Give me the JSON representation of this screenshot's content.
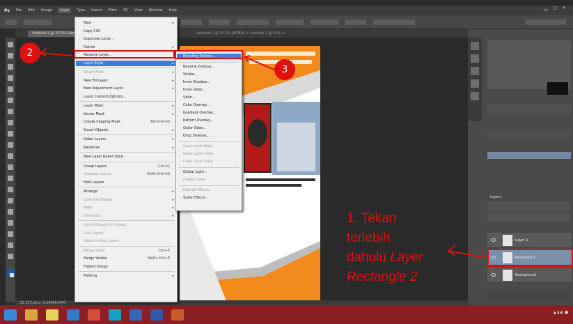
{
  "menubar": {
    "logo": "Ps",
    "items": [
      "File",
      "Edit",
      "Image",
      "Layer",
      "Type",
      "Select",
      "Filter",
      "3D",
      "View",
      "Window",
      "Help"
    ]
  },
  "document_tab": {
    "title": "Untitled-1 @ 33.3% (Rectangle 2, RGB/8)",
    "other_tabs": "Untitled-2 @ 33.3% (RGB/8) ×   Untitled-3 @ 50% ×"
  },
  "layer_menu": {
    "items": [
      {
        "label": "New",
        "shortcut": "▸"
      },
      {
        "label": "Copy CSS",
        "shortcut": ""
      },
      {
        "label": "Duplicate Layer...",
        "shortcut": ""
      },
      {
        "label": "Delete",
        "shortcut": "▸"
      },
      {
        "label": "Rename Layer...",
        "shortcut": ""
      },
      {
        "label": "Layer Style",
        "shortcut": "▸",
        "highlighted": true
      },
      {
        "label": "Smart Filter",
        "shortcut": "▸",
        "dim": true
      },
      {
        "label": "New Fill Layer",
        "shortcut": "▸"
      },
      {
        "label": "New Adjustment Layer",
        "shortcut": "▸"
      },
      {
        "label": "Layer Content Options...",
        "shortcut": ""
      },
      {
        "label": "Layer Mask",
        "shortcut": "▸"
      },
      {
        "label": "Vector Mask",
        "shortcut": "▸"
      },
      {
        "label": "Create Clipping Mask",
        "shortcut": "Alt+Ctrl+G"
      },
      {
        "label": "Smart Objects",
        "shortcut": "▸"
      },
      {
        "label": "Video Layers",
        "shortcut": "▸"
      },
      {
        "label": "Rasterize",
        "shortcut": "▸"
      },
      {
        "label": "New Layer Based Slice",
        "shortcut": ""
      },
      {
        "label": "Group Layers",
        "shortcut": "Ctrl+G"
      },
      {
        "label": "Ungroup Layers",
        "shortcut": "Shift+Ctrl+G",
        "dim": true
      },
      {
        "label": "Hide Layers",
        "shortcut": ""
      },
      {
        "label": "Arrange",
        "shortcut": "▸"
      },
      {
        "label": "Combine Shapes",
        "shortcut": "▸",
        "dim": true
      },
      {
        "label": "Align",
        "shortcut": "▸",
        "dim": true
      },
      {
        "label": "Distribute",
        "shortcut": "▸",
        "dim": true
      },
      {
        "label": "Lock All Layers in Group...",
        "shortcut": "",
        "dim": true
      },
      {
        "label": "Link Layers",
        "shortcut": "",
        "dim": true
      },
      {
        "label": "Select Linked Layers",
        "shortcut": "",
        "dim": true
      },
      {
        "label": "Merge Down",
        "shortcut": "Ctrl+E",
        "dim": true
      },
      {
        "label": "Merge Visible",
        "shortcut": "Shift+Ctrl+E"
      },
      {
        "label": "Flatten Image",
        "shortcut": ""
      },
      {
        "label": "Matting",
        "shortcut": "▸"
      }
    ]
  },
  "layer_style_submenu": {
    "items": [
      {
        "label": "Blending Options...",
        "highlighted": true
      },
      {
        "label": "Bevel & Emboss..."
      },
      {
        "label": "Stroke..."
      },
      {
        "label": "Inner Shadow..."
      },
      {
        "label": "Inner Glow..."
      },
      {
        "label": "Satin..."
      },
      {
        "label": "Color Overlay..."
      },
      {
        "label": "Gradient Overlay..."
      },
      {
        "label": "Pattern Overlay..."
      },
      {
        "label": "Outer Glow..."
      },
      {
        "label": "Drop Shadow..."
      },
      {
        "label": "Copy Layer Style",
        "dim": true
      },
      {
        "label": "Paste Layer Style",
        "dim": true
      },
      {
        "label": "Clear Layer Style",
        "dim": true
      },
      {
        "label": "Global Light..."
      },
      {
        "label": "Create Layer",
        "dim": true
      },
      {
        "label": "Hide All Effects",
        "dim": true
      },
      {
        "label": "Scale Effects..."
      }
    ]
  },
  "layers_panel": {
    "title": "Layers",
    "rows": [
      {
        "name": "Layer 1",
        "selected": false
      },
      {
        "name": "Rectangle 2",
        "selected": true
      },
      {
        "name": "Background",
        "selected": false
      }
    ]
  },
  "status": {
    "text": "33.33%   Doc: 6.59M/8.64M"
  },
  "annotation": {
    "badge_2": "2",
    "badge_3": "3",
    "line1": "1. Tekan",
    "line2": "terlebih",
    "line3_plain": "dahulu ",
    "line3_italic": "Layer",
    "line4_italic": "Rectangle 2"
  },
  "colors": {
    "annotation_red": "#e01010",
    "menu_highlight": "#3d7fd6",
    "taskbar": "#8a1f24",
    "brochure_orange": "#f28a1c"
  }
}
